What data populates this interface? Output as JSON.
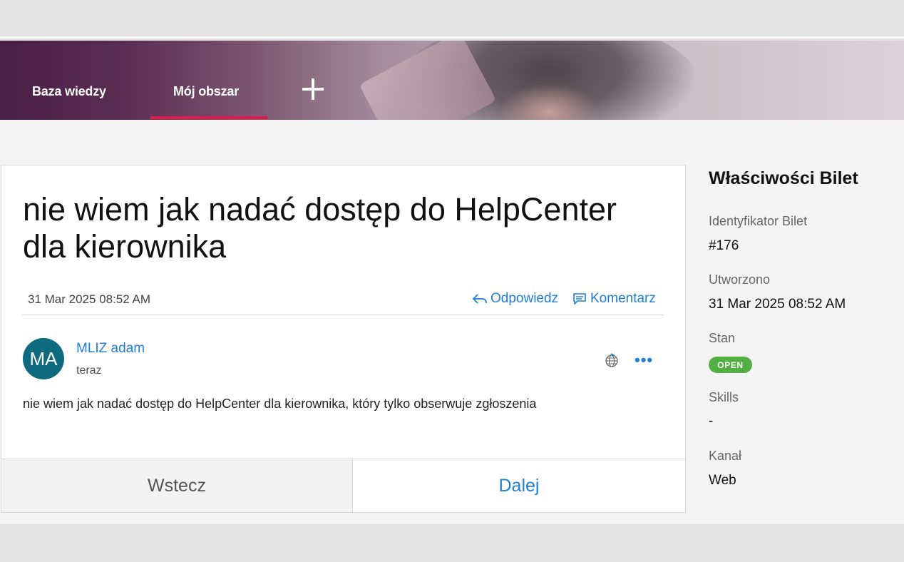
{
  "nav": {
    "items": [
      {
        "label": "Baza wiedzy"
      },
      {
        "label": "Mój obszar"
      }
    ],
    "active_index": 1,
    "add_icon": "plus-icon",
    "accent_color": "#e2194d"
  },
  "ticket": {
    "title": "nie wiem jak nadać dostęp do HelpCenter dla kierownika",
    "date": "31 Mar 2025 08:52 AM",
    "reply_label": "Odpowiedz",
    "reply_icon": "reply-icon",
    "comment_label": "Komentarz",
    "comment_icon": "comment-icon"
  },
  "post": {
    "avatar_initials": "MA",
    "avatar_color": "#0e6a7e",
    "author": "MLIZ adam",
    "time": "teraz",
    "channel_icon": "globe-icon",
    "more_icon": "more-icon",
    "body": "nie wiem jak nadać dostęp do HelpCenter dla kierownika, który tylko obserwuje zgłoszenia"
  },
  "pager": {
    "back_label": "Wstecz",
    "next_label": "Dalej"
  },
  "properties": {
    "title": "Właściwości Bilet",
    "id_label": "Identyfikator Bilet",
    "id_value": "#176",
    "created_label": "Utworzono",
    "created_value": "31 Mar 2025 08:52 AM",
    "status_label": "Stan",
    "status_value": "OPEN",
    "status_color": "#52b043",
    "skills_label": "Skills",
    "skills_value": "-",
    "channel_label": "Kanał",
    "channel_value": "Web"
  },
  "colors": {
    "link": "#1f7fd6",
    "banner_dark": "#4a1f45"
  }
}
